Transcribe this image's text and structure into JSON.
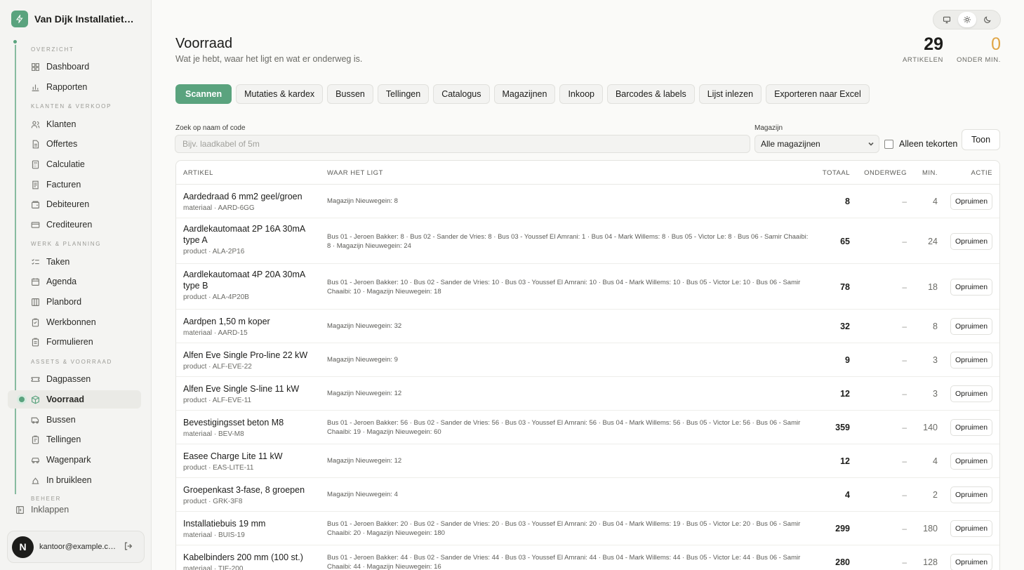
{
  "brand": {
    "name": "Van Dijk Installatietechniek"
  },
  "sidebar": {
    "sections": [
      "OVERZICHT",
      "KLANTEN & VERKOOP",
      "WERK & PLANNING",
      "ASSETS & VOORRAAD",
      "BEHEER"
    ],
    "items": [
      {
        "label": "Dashboard",
        "icon": "grid-icon"
      },
      {
        "label": "Rapporten",
        "icon": "bar-chart-icon"
      },
      {
        "label": "Klanten",
        "icon": "users-icon"
      },
      {
        "label": "Offertes",
        "icon": "document-icon"
      },
      {
        "label": "Calculatie",
        "icon": "calculator-icon"
      },
      {
        "label": "Facturen",
        "icon": "invoice-icon"
      },
      {
        "label": "Debiteuren",
        "icon": "wallet-icon"
      },
      {
        "label": "Crediteuren",
        "icon": "card-icon"
      },
      {
        "label": "Taken",
        "icon": "list-check-icon"
      },
      {
        "label": "Agenda",
        "icon": "calendar-icon"
      },
      {
        "label": "Planbord",
        "icon": "columns-icon"
      },
      {
        "label": "Werkbonnen",
        "icon": "clipboard-icon"
      },
      {
        "label": "Formulieren",
        "icon": "form-icon"
      },
      {
        "label": "Dagpassen",
        "icon": "ticket-icon"
      },
      {
        "label": "Voorraad",
        "icon": "box-icon",
        "active": true
      },
      {
        "label": "Bussen",
        "icon": "van-icon"
      },
      {
        "label": "Tellingen",
        "icon": "clipboard-list-icon"
      },
      {
        "label": "Wagenpark",
        "icon": "car-icon"
      },
      {
        "label": "In bruikleen",
        "icon": "lend-icon"
      }
    ],
    "collapse_label": "Inklappen",
    "user": {
      "initial": "N",
      "email": "kantoor@example.com"
    }
  },
  "header": {
    "title": "Voorraad",
    "subtitle": "Wat je hebt, waar het ligt en wat er onderweg is.",
    "stats": [
      {
        "value": "29",
        "label": "ARTIKELEN"
      },
      {
        "value": "0",
        "label": "ONDER MIN."
      }
    ]
  },
  "tabs": [
    "Scannen",
    "Mutaties & kardex",
    "Bussen",
    "Tellingen",
    "Catalogus",
    "Magazijnen",
    "Inkoop",
    "Barcodes & labels",
    "Lijst inlezen",
    "Exporteren naar Excel"
  ],
  "filters": {
    "search_label": "Zoek op naam of code",
    "search_placeholder": "Bijv. laadkabel of 5m",
    "search_value": "",
    "warehouse_label": "Magazijn",
    "warehouse_value": "Alle magazijnen",
    "shortage_label": "Alleen tekorten",
    "show_button": "Toon"
  },
  "table": {
    "columns": [
      "ARTIKEL",
      "WAAR HET LIGT",
      "TOTAAL",
      "ONDERWEG",
      "MIN.",
      "ACTIE"
    ],
    "action_label": "Opruimen",
    "rows": [
      {
        "name": "Aardedraad 6 mm2 geel/groen",
        "sub": "materiaal · AARD-6GG",
        "where": "Magazijn Nieuwegein: 8",
        "total": "8",
        "onderweg": "–",
        "min": "4"
      },
      {
        "name": "Aardlekautomaat 2P 16A 30mA type A",
        "sub": "product · ALA-2P16",
        "where": "Bus 01 - Jeroen Bakker: 8 · Bus 02 - Sander de Vries: 8 · Bus 03 - Youssef El Amrani: 1 · Bus 04 - Mark Willems: 8 · Bus 05 - Victor Le: 8 · Bus 06 - Samir Chaaibi: 8 · Magazijn Nieuwegein: 24",
        "total": "65",
        "onderweg": "–",
        "min": "24"
      },
      {
        "name": "Aardlekautomaat 4P 20A 30mA type B",
        "sub": "product · ALA-4P20B",
        "where": "Bus 01 - Jeroen Bakker: 10 · Bus 02 - Sander de Vries: 10 · Bus 03 - Youssef El Amrani: 10 · Bus 04 - Mark Willems: 10 · Bus 05 - Victor Le: 10 · Bus 06 - Samir Chaaibi: 10 · Magazijn Nieuwegein: 18",
        "total": "78",
        "onderweg": "–",
        "min": "18"
      },
      {
        "name": "Aardpen 1,50 m koper",
        "sub": "materiaal · AARD-15",
        "where": "Magazijn Nieuwegein: 32",
        "total": "32",
        "onderweg": "–",
        "min": "8"
      },
      {
        "name": "Alfen Eve Single Pro-line 22 kW",
        "sub": "product · ALF-EVE-22",
        "where": "Magazijn Nieuwegein: 9",
        "total": "9",
        "onderweg": "–",
        "min": "3"
      },
      {
        "name": "Alfen Eve Single S-line 11 kW",
        "sub": "product · ALF-EVE-11",
        "where": "Magazijn Nieuwegein: 12",
        "total": "12",
        "onderweg": "–",
        "min": "3"
      },
      {
        "name": "Bevestigingsset beton M8",
        "sub": "materiaal · BEV-M8",
        "where": "Bus 01 - Jeroen Bakker: 56 · Bus 02 - Sander de Vries: 56 · Bus 03 - Youssef El Amrani: 56 · Bus 04 - Mark Willems: 56 · Bus 05 - Victor Le: 56 · Bus 06 - Samir Chaaibi: 19 · Magazijn Nieuwegein: 60",
        "total": "359",
        "onderweg": "–",
        "min": "140"
      },
      {
        "name": "Easee Charge Lite 11 kW",
        "sub": "product · EAS-LITE-11",
        "where": "Magazijn Nieuwegein: 12",
        "total": "12",
        "onderweg": "–",
        "min": "4"
      },
      {
        "name": "Groepenkast 3-fase, 8 groepen",
        "sub": "product · GRK-3F8",
        "where": "Magazijn Nieuwegein: 4",
        "total": "4",
        "onderweg": "–",
        "min": "2"
      },
      {
        "name": "Installatiebuis 19 mm",
        "sub": "materiaal · BUIS-19",
        "where": "Bus 01 - Jeroen Bakker: 20 · Bus 02 - Sander de Vries: 20 · Bus 03 - Youssef El Amrani: 20 · Bus 04 - Mark Willems: 19 · Bus 05 - Victor Le: 20 · Bus 06 - Samir Chaaibi: 20 · Magazijn Nieuwegein: 180",
        "total": "299",
        "onderweg": "–",
        "min": "180"
      },
      {
        "name": "Kabelbinders 200 mm (100 st.)",
        "sub": "materiaal · TIE-200",
        "where": "Bus 01 - Jeroen Bakker: 44 · Bus 02 - Sander de Vries: 44 · Bus 03 - Youssef El Amrani: 44 · Bus 04 - Mark Willems: 44 · Bus 05 - Victor Le: 44 · Bus 06 - Samir Chaaibi: 44 · Magazijn Nieuwegein: 16",
        "total": "280",
        "onderweg": "–",
        "min": "128"
      }
    ]
  }
}
